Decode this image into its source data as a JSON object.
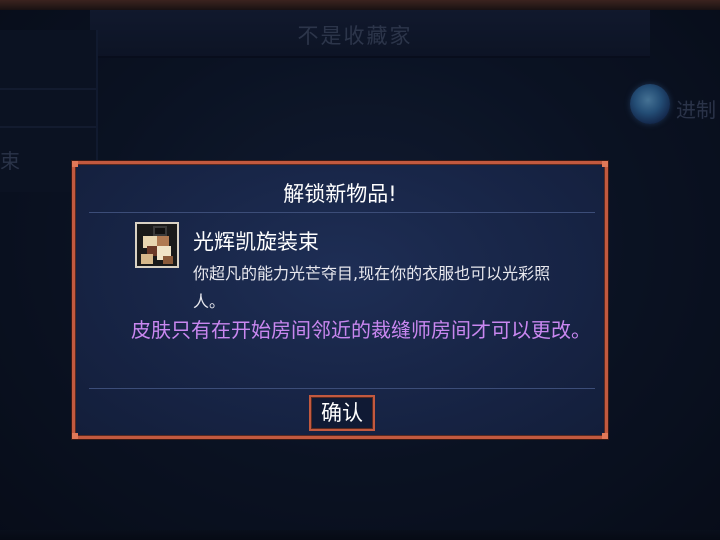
{
  "background": {
    "header_title": "不是收藏家",
    "left_text": "束",
    "right_text": "进制"
  },
  "dialog": {
    "title": "解锁新物品!",
    "item_name": "光辉凯旋装束",
    "item_description": "你超凡的能力光芒夺目,现在你的衣服也可以光彩照人。",
    "note": "皮肤只有在开始房间邻近的裁缝师房间才可以更改。",
    "confirm_label": "确认"
  },
  "colors": {
    "border": "#c2593f",
    "note_text": "#c987f0",
    "panel": "#172445"
  }
}
